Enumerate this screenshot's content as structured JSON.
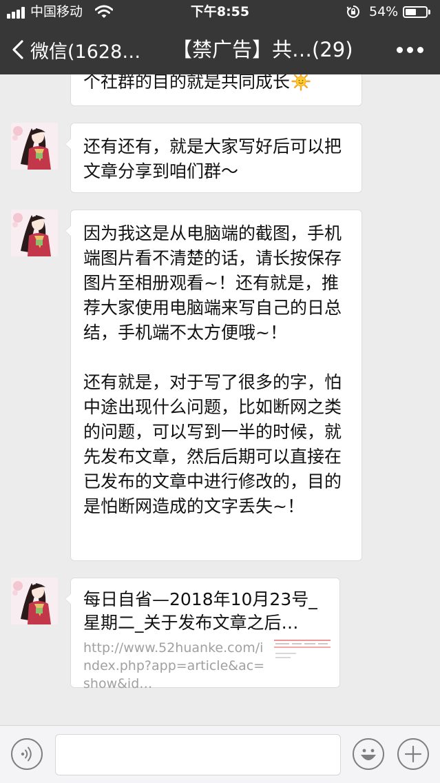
{
  "status_bar": {
    "carrier": "中国移动",
    "time": "下午8:55",
    "battery_text": "54%",
    "battery_level": 0.54,
    "icons": [
      "signal-icon",
      "wifi-icon",
      "rotation-lock-icon",
      "battery-icon"
    ]
  },
  "nav": {
    "back_label": "微信(1628…",
    "title": "【禁广告】共…(29)",
    "icons": [
      "chevron-left-icon",
      "more-icon"
    ]
  },
  "messages": [
    {
      "text": "个社群的目的就是共同成长",
      "trailing_emoji": "sun-icon"
    },
    {
      "text": "还有还有，就是大家写好后可以把文章分享到咱们群～"
    },
    {
      "paragraphs": [
        "因为我这是从电脑端的截图，手机端图片看不清楚的话，请长按保存图片至相册观看~！还有就是，推荐大家使用电脑端来写自己的日总结，手机端不太方便哦~！",
        "还有就是，对于写了很多的字，怕中途出现什么问题，比如断网之类的问题，可以写到一半的时候，就先发布文章，然后后期可以直接在已发布的文章中进行修改的，目的是怕断网造成的文字丢失~！"
      ]
    },
    {
      "link": {
        "title": "每日自省—2018年10月23号_星期二_关于发布文章之后…",
        "url": "http://www.52huanke.com/index.php?app=article&ac=show&id…"
      }
    }
  ],
  "input_bar": {
    "icons": [
      "voice-icon",
      "emoji-icon",
      "plus-icon"
    ]
  },
  "colors": {
    "header_bg": "#373737",
    "chat_bg": "#ececec",
    "bubble_bg": "#ffffff",
    "link_url": "#a0a0a0"
  }
}
